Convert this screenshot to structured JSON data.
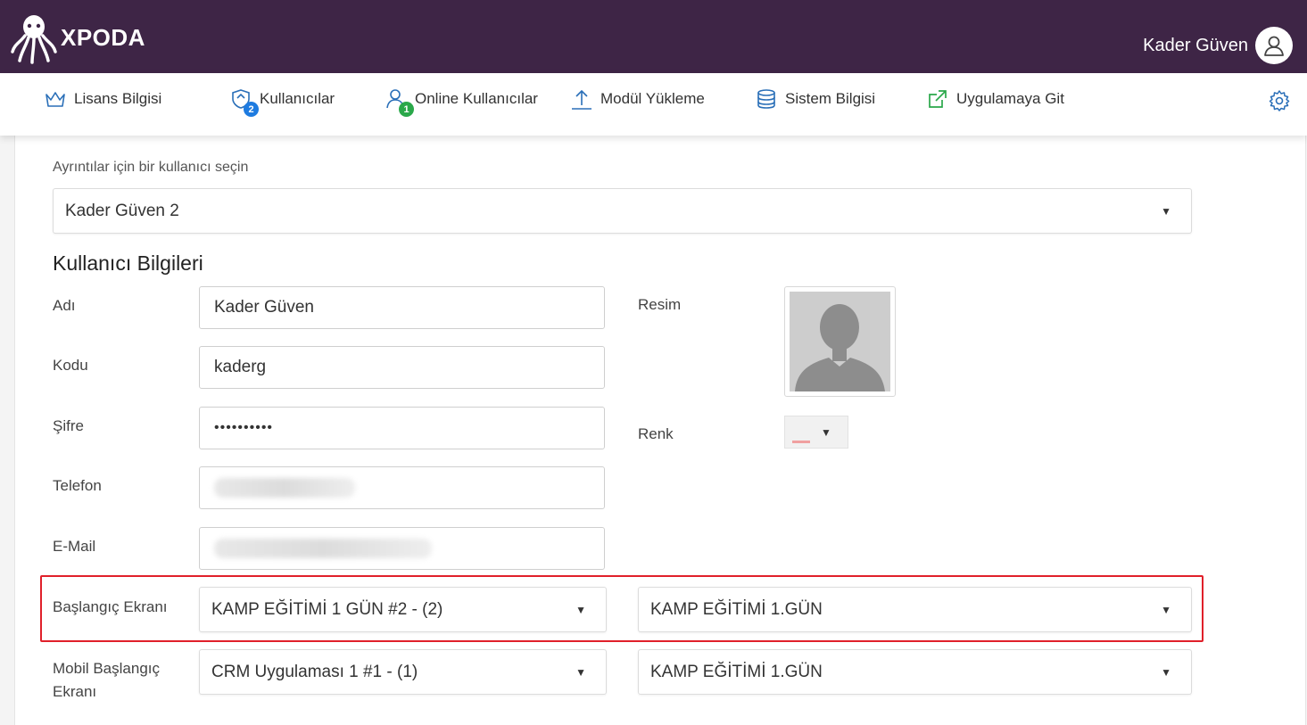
{
  "header": {
    "brand": "XPODA",
    "user_name": "Kader Güven"
  },
  "nav": {
    "items": [
      {
        "label": "Lisans Bilgisi",
        "icon": "crown-icon"
      },
      {
        "label": "Kullanıcılar",
        "icon": "users-shield-icon",
        "badge": "2",
        "badge_color": "#1e7be0"
      },
      {
        "label": "Online Kullanıcılar",
        "icon": "user-online-icon",
        "badge": "1",
        "badge_color": "#2aa84a"
      },
      {
        "label": "Modül Yükleme",
        "icon": "upload-icon"
      },
      {
        "label": "Sistem Bilgisi",
        "icon": "database-icon"
      },
      {
        "label": "Uygulamaya Git",
        "icon": "external-link-icon"
      }
    ],
    "settings_icon": "gear-icon"
  },
  "form": {
    "select_label": "Ayrıntılar için bir kullanıcı seçin",
    "selected_user": "Kader Güven 2",
    "section_title": "Kullanıcı Bilgileri",
    "fields": {
      "name_label": "Adı",
      "name_value": "Kader Güven",
      "code_label": "Kodu",
      "code_value": "kaderg",
      "password_label": "Şifre",
      "password_value": "••••••••••",
      "phone_label": "Telefon",
      "email_label": "E-Mail",
      "photo_label": "Resim",
      "color_label": "Renk",
      "start_screen_label": "Başlangıç Ekranı",
      "start_screen_app": "KAMP EĞİTİMİ 1 GÜN #2 - (2)",
      "start_screen_page": "KAMP EĞİTİMİ 1.GÜN",
      "mobile_start_label": "Mobil Başlangıç Ekranı",
      "mobile_start_app": "CRM Uygulaması 1 #1 - (1)",
      "mobile_start_page": "KAMP EĞİTİMİ 1.GÜN"
    }
  },
  "colors": {
    "header_bg": "#3e2546",
    "highlight": "#e0202a",
    "icon_primary": "#2a6fb8",
    "icon_green": "#2aa84a"
  }
}
